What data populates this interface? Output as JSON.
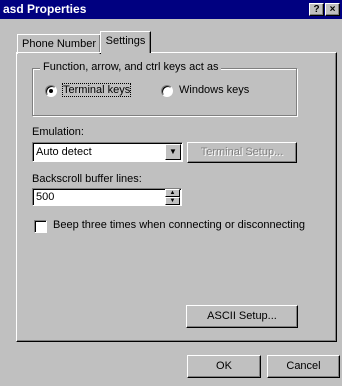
{
  "window": {
    "title": "asd Properties",
    "help_glyph": "?",
    "close_glyph": "×"
  },
  "tabs": [
    {
      "label": "Phone Number",
      "selected": false
    },
    {
      "label": "Settings",
      "selected": true
    }
  ],
  "keys_group": {
    "label": "Function, arrow, and ctrl keys act as",
    "options": [
      {
        "label": "Terminal keys",
        "selected": true
      },
      {
        "label": "Windows keys",
        "selected": false
      }
    ]
  },
  "emulation": {
    "label": "Emulation:",
    "value": "Auto detect",
    "terminal_setup_label": "Terminal Setup...",
    "terminal_setup_enabled": false
  },
  "backscroll": {
    "label": "Backscroll buffer lines:",
    "value": "500"
  },
  "beep": {
    "label": "Beep three times when connecting or disconnecting",
    "checked": false
  },
  "buttons": {
    "ascii_setup": "ASCII Setup...",
    "ok": "OK",
    "cancel": "Cancel"
  },
  "colors": {
    "titlebar": "#000080",
    "face": "#c0c0c0",
    "disabled_text": "#808080"
  }
}
